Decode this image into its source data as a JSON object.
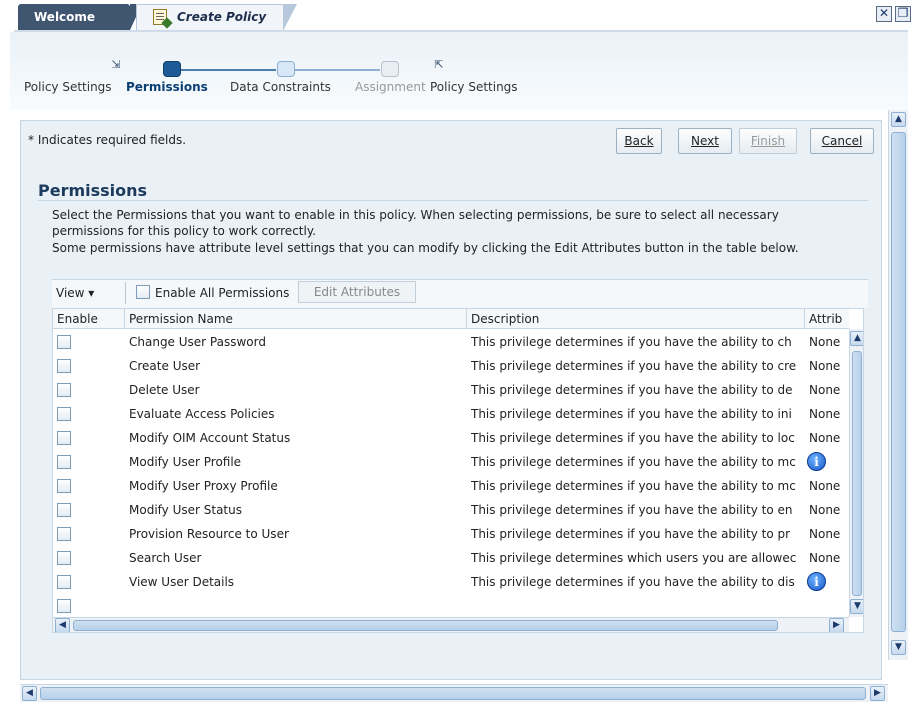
{
  "tabs": {
    "welcome": "Welcome",
    "active": "Create Policy"
  },
  "train": {
    "stops": [
      {
        "label": "Policy Settings",
        "state": "visited"
      },
      {
        "label": "Permissions",
        "state": "current"
      },
      {
        "label": "Data Constraints",
        "state": "future"
      },
      {
        "label": "Assignment",
        "state": "disabled"
      },
      {
        "label": "Policy Settings",
        "state": "next-train"
      }
    ]
  },
  "form": {
    "required_note": "* Indicates required fields.",
    "buttons": {
      "back": "Back",
      "next": "Next",
      "finish": "Finish",
      "cancel": "Cancel"
    }
  },
  "section": {
    "title": "Permissions",
    "description": [
      "Select the Permissions that you want to enable in this policy. When selecting permissions, be sure to select all necessary",
      "permissions for this policy to work correctly.",
      "Some permissions have attribute level settings that you can modify by clicking the Edit Attributes button in the table below."
    ]
  },
  "toolbar": {
    "view_menu": "View ▾",
    "enable_all": "Enable All Permissions",
    "edit_attributes": "Edit Attributes"
  },
  "table": {
    "columns": [
      "Enable",
      "Permission Name",
      "Description",
      "Attrib"
    ],
    "rows": [
      {
        "name": "Change User Password",
        "desc": "This privilege determines if you have the ability to ch",
        "attr": "None",
        "attr_icon": false
      },
      {
        "name": "Create User",
        "desc": "This privilege determines if you have the ability to cre",
        "attr": "None",
        "attr_icon": false
      },
      {
        "name": "Delete User",
        "desc": "This privilege determines if you have the ability to de",
        "attr": "None",
        "attr_icon": false
      },
      {
        "name": "Evaluate Access Policies",
        "desc": "This privilege determines if you have the ability to ini",
        "attr": "None",
        "attr_icon": false
      },
      {
        "name": "Modify OIM Account Status",
        "desc": "This privilege determines if you have the ability to loc",
        "attr": "None",
        "attr_icon": false
      },
      {
        "name": "Modify User Profile",
        "desc": "This privilege determines if you have the ability to mc",
        "attr": "",
        "attr_icon": true
      },
      {
        "name": "Modify User Proxy Profile",
        "desc": "This privilege determines if you have the ability to mc",
        "attr": "None",
        "attr_icon": false
      },
      {
        "name": "Modify User Status",
        "desc": "This privilege determines if you have the ability to en",
        "attr": "None",
        "attr_icon": false
      },
      {
        "name": "Provision Resource to User",
        "desc": "This privilege determines if you have the ability to pr",
        "attr": "None",
        "attr_icon": false
      },
      {
        "name": "Search User",
        "desc": "This privilege determines which users you are allowec",
        "attr": "None",
        "attr_icon": false
      },
      {
        "name": "View User Details",
        "desc": "This privilege determines if you have the ability to dis",
        "attr": "",
        "attr_icon": true
      }
    ],
    "info_glyph": "i"
  },
  "icons": {
    "close": "close-icon",
    "restore": "restore-icon"
  }
}
